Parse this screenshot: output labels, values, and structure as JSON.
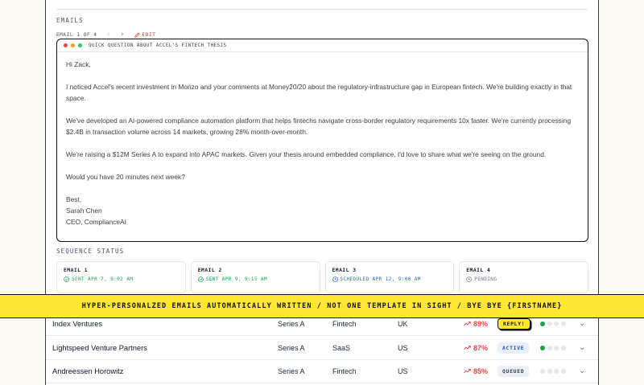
{
  "emails": {
    "section_label": "EMAILS",
    "counter": "EMAIL 1 OF 4",
    "edit_label": "EDIT",
    "window": {
      "subject": "QUICK QUESTION ABOUT ACCEL'S FINTECH THESIS",
      "dot_colors": [
        "#ef4444",
        "#f59e0b",
        "#22c55e"
      ],
      "body": [
        "Hi Zack,",
        "I noticed Accel's recent investment in Monzo and your comments at Money20/20 about the regulatory-infrastructure gap in European fintech. We're building exactly in that space.",
        "We've developed an AI-powered compliance automation platform that helps fintechs navigate cross-border regulatory requirements 10x faster. We're currently processing $2.4B in transaction volume across 14 markets, growing 28% month-over-month.",
        "We're raising a $12M Series A to expand into APAC markets. Given your thesis around embedded compliance, I'd love to share what we're seeing on the ground.",
        "Would you have 20 minutes next week?"
      ],
      "signoff": [
        "Best,",
        "Sarah Chen",
        "CEO, ComplianceAI"
      ]
    }
  },
  "sequence": {
    "section_label": "SEQUENCE STATUS",
    "steps": [
      {
        "title": "EMAIL 1",
        "status": "SENT APR 7, 9:02 AM",
        "icon": "check-circle-icon",
        "color": "#16a34a"
      },
      {
        "title": "EMAIL 2",
        "status": "SENT APR 9, 9:15 AM",
        "icon": "check-circle-icon",
        "color": "#16a34a"
      },
      {
        "title": "EMAIL 3",
        "status": "SCHEDULED APR 12, 9:00 AM",
        "icon": "clock-icon",
        "color": "#2563eb"
      },
      {
        "title": "EMAIL 4",
        "status": "PENDING",
        "icon": "clock-icon",
        "color": "#6b7280"
      }
    ]
  },
  "banner": {
    "text": "HYPER-PERSONALZED EMAILS AUTOMATICALLY WRITTEN / NOT ONE TEMPLATE IN SIGHT / BYE BYE {FIRSTNAME}",
    "background": "#fde733"
  },
  "investors": [
    {
      "name": "Index Ventures",
      "stage": "Series A",
      "sector": "Fintech",
      "region": "UK",
      "score": "89%",
      "status": "REPLY!",
      "status_style": "reply",
      "progress": 1
    },
    {
      "name": "Lightspeed Venture Partners",
      "stage": "Series A",
      "sector": "SaaS",
      "region": "US",
      "score": "87%",
      "status": "ACTIVE",
      "status_style": "active",
      "progress": 1
    },
    {
      "name": "Andreessen Horowitz",
      "stage": "Series A",
      "sector": "Fintech",
      "region": "US",
      "score": "85%",
      "status": "QUEUED",
      "status_style": "queued",
      "progress": 0
    }
  ]
}
